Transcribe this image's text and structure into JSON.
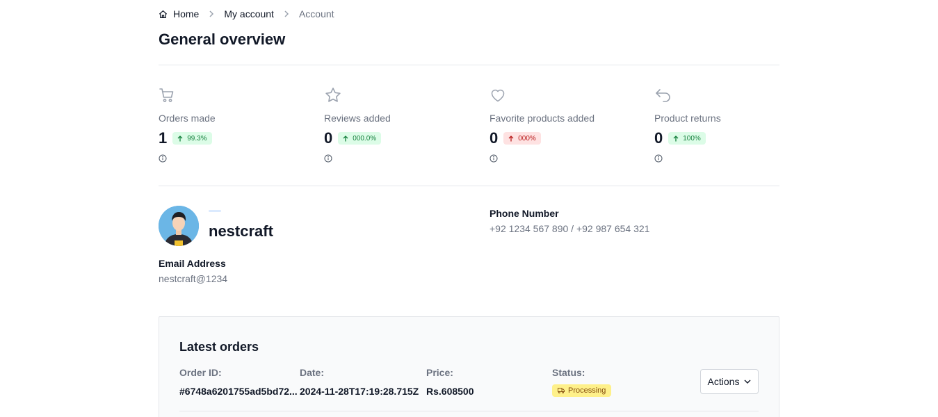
{
  "breadcrumb": {
    "home": "Home",
    "my_account": "My account",
    "account": "Account"
  },
  "page_title": "General overview",
  "stats": [
    {
      "icon": "cart-icon",
      "label": "Orders made",
      "value": "1",
      "change": "99.3%",
      "trend": "up"
    },
    {
      "icon": "star-icon",
      "label": "Reviews added",
      "value": "0",
      "change": "000.0%",
      "trend": "up"
    },
    {
      "icon": "heart-icon",
      "label": "Favorite products added",
      "value": "0",
      "change": "000%",
      "trend": "down"
    },
    {
      "icon": "return-icon",
      "label": "Product returns",
      "value": "0",
      "change": "100%",
      "trend": "up"
    }
  ],
  "profile": {
    "username": "nestcraft",
    "email_label": "Email Address",
    "email": "nestcraft@1234",
    "phone_label": "Phone Number",
    "phone": "+92 1234 567 890 / +92 987 654 321"
  },
  "orders": {
    "title": "Latest orders",
    "columns": {
      "order_id": "Order ID:",
      "date": "Date:",
      "price": "Price:",
      "status": "Status:"
    },
    "rows": [
      {
        "order_id": "#6748a6201755ad5bd72...",
        "date": "2024-11-28T17:19:28.715Z",
        "price": "Rs.608500",
        "status": "Processing"
      }
    ],
    "actions_label": "Actions"
  },
  "colors": {
    "up_bg": "#dcfce7",
    "up_text": "#15803d",
    "down_bg": "#fee2e2",
    "down_text": "#b91c1c",
    "processing_bg": "#fef08a",
    "processing_text": "#854d0e"
  }
}
